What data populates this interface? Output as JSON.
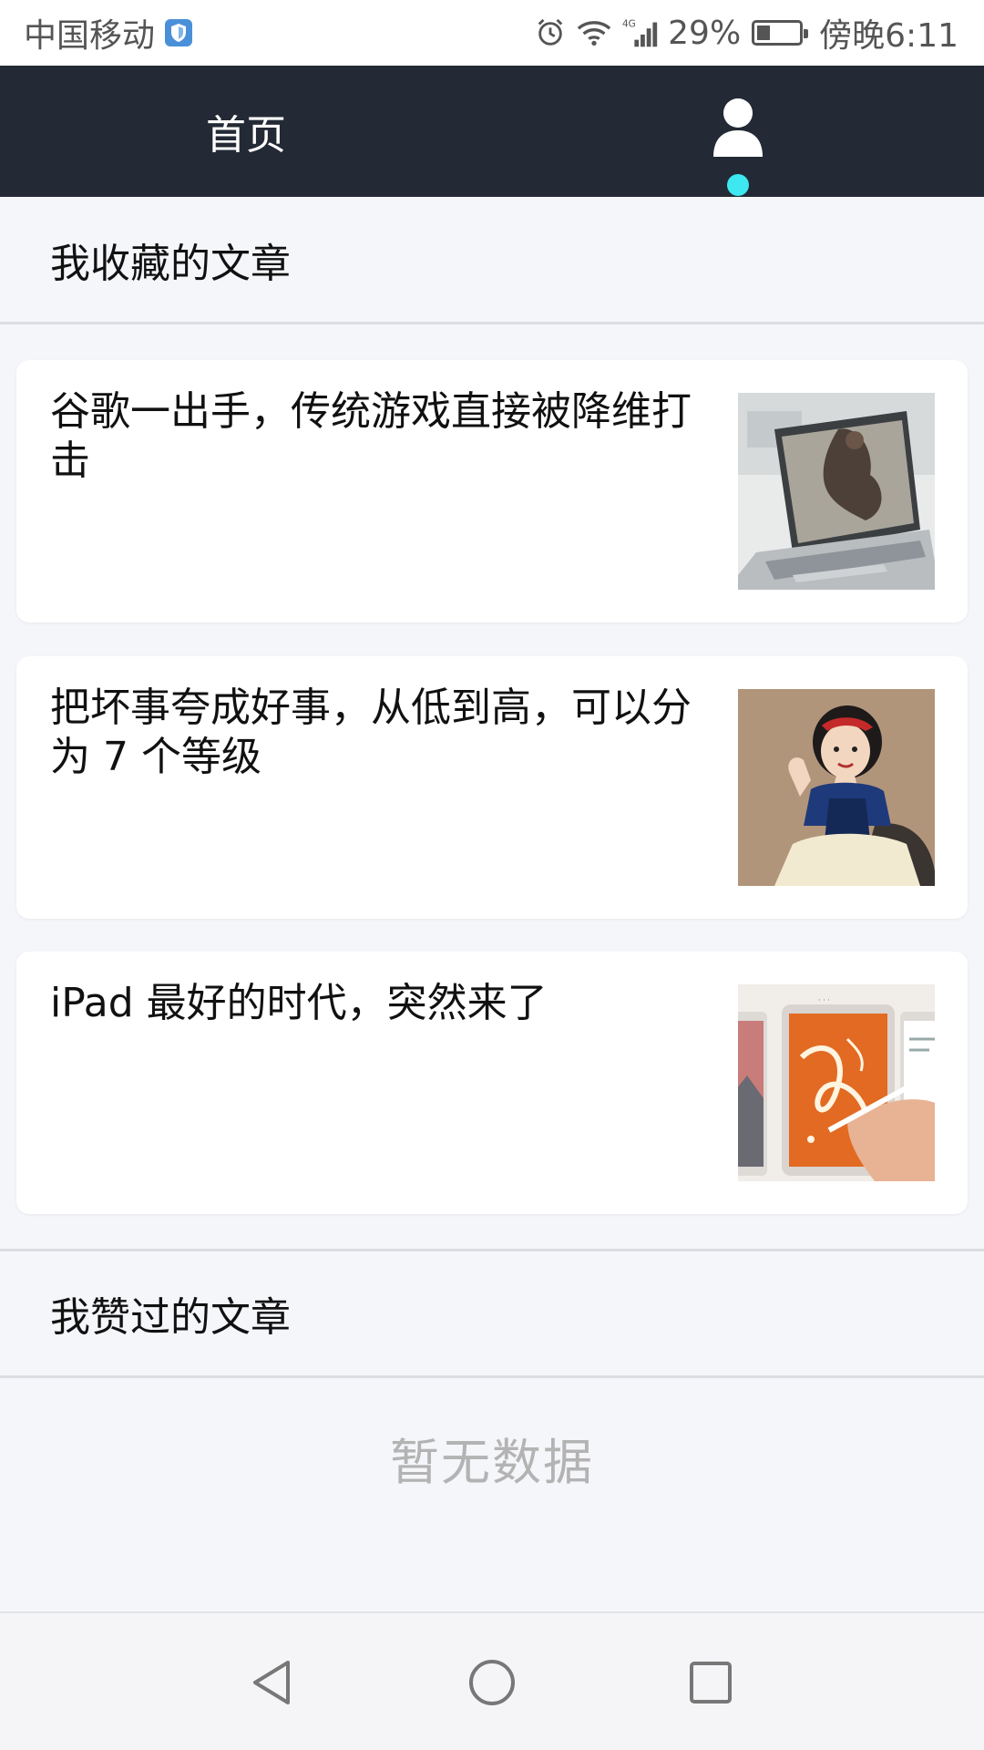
{
  "status_bar": {
    "carrier": "中国移动",
    "network": "4G",
    "battery": "29%",
    "time": "傍晚6:11"
  },
  "top_nav": {
    "home_label": "首页",
    "active_tab": "profile",
    "active_color": "#3de8f0",
    "background": "#232a35"
  },
  "favorites": {
    "header": "我收藏的文章",
    "articles": [
      {
        "title": "谷歌一出手，传统游戏直接被降维打击",
        "thumb_icon": "laptop-game-thumbnail"
      },
      {
        "title": "把坏事夸成好事，从低到高，可以分为 7 个等级",
        "thumb_icon": "snow-white-thumbnail"
      },
      {
        "title": "iPad 最好的时代，突然来了",
        "thumb_icon": "ipad-thumbnail"
      }
    ]
  },
  "liked": {
    "header": "我赞过的文章",
    "empty_text": "暂无数据"
  },
  "system_nav": {
    "icons": [
      "back-icon",
      "home-icon",
      "recent-apps-icon"
    ]
  }
}
